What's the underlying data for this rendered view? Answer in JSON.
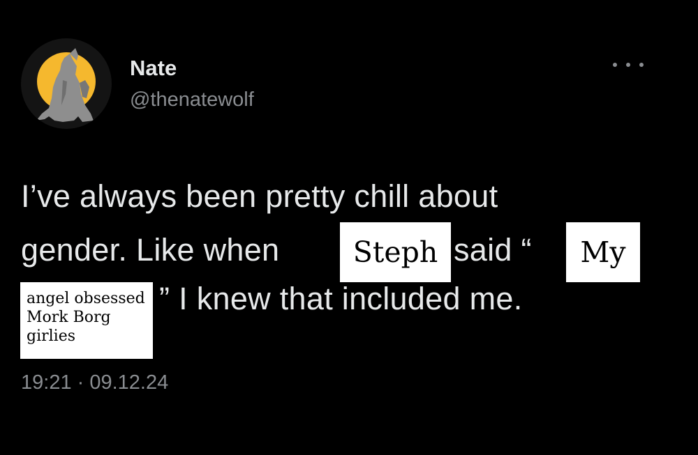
{
  "tweet": {
    "author": {
      "display_name": "Nate",
      "handle": "@thenatewolf",
      "avatar": "howling-wolf-moon-avatar"
    },
    "more_icon": "ellipsis-icon",
    "body": {
      "line1": "I’ve always been pretty chill about",
      "line2_start": "gender. Like when",
      "line2_end": "said “",
      "line3": "” I knew that included me."
    },
    "timestamp": "19:21 · 09.12.24"
  },
  "overlays": {
    "name_label": "Steph",
    "quote_start_label": "My",
    "quote_rest_label": "angel obsessed\nMork Borg\ngirlies"
  },
  "colors": {
    "background": "#000000",
    "text_primary": "#e7e9ea",
    "text_secondary": "#8a8d91",
    "moon": "#f5b82e",
    "overlay_bg": "#ffffff"
  }
}
